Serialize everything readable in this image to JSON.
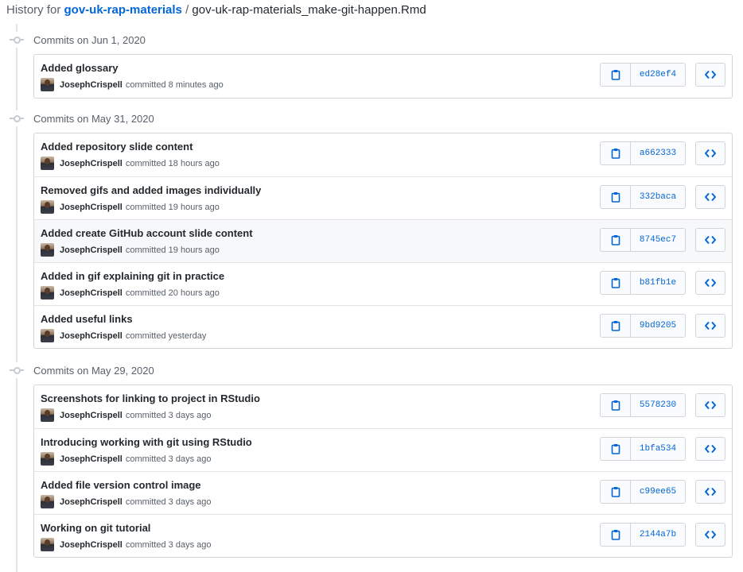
{
  "header": {
    "prefix": "History for",
    "repo": "gov-uk-rap-materials",
    "separator": "/",
    "file": "gov-uk-rap-materials_make-git-happen.Rmd"
  },
  "groups": [
    {
      "date_label": "Commits on Jun 1, 2020",
      "commits": [
        {
          "message": "Added glossary",
          "author": "JosephCrispell",
          "verb": "committed",
          "time": "8 minutes ago",
          "sha": "ed28ef4"
        }
      ]
    },
    {
      "date_label": "Commits on May 31, 2020",
      "commits": [
        {
          "message": "Added repository slide content",
          "author": "JosephCrispell",
          "verb": "committed",
          "time": "18 hours ago",
          "sha": "a662333"
        },
        {
          "message": "Removed gifs and added images individually",
          "author": "JosephCrispell",
          "verb": "committed",
          "time": "19 hours ago",
          "sha": "332baca"
        },
        {
          "message": "Added create GitHub account slide content",
          "author": "JosephCrispell",
          "verb": "committed",
          "time": "19 hours ago",
          "sha": "8745ec7"
        },
        {
          "message": "Added in gif explaining git in practice",
          "author": "JosephCrispell",
          "verb": "committed",
          "time": "20 hours ago",
          "sha": "b81fb1e"
        },
        {
          "message": "Added useful links",
          "author": "JosephCrispell",
          "verb": "committed",
          "time": "yesterday",
          "sha": "9bd9205"
        }
      ]
    },
    {
      "date_label": "Commits on May 29, 2020",
      "commits": [
        {
          "message": "Screenshots for linking to project in RStudio",
          "author": "JosephCrispell",
          "verb": "committed",
          "time": "3 days ago",
          "sha": "5578230"
        },
        {
          "message": "Introducing working with git using RStudio",
          "author": "JosephCrispell",
          "verb": "committed",
          "time": "3 days ago",
          "sha": "1bfa534"
        },
        {
          "message": "Added file version control image",
          "author": "JosephCrispell",
          "verb": "committed",
          "time": "3 days ago",
          "sha": "c99ee65"
        },
        {
          "message": "Working on git tutorial",
          "author": "JosephCrispell",
          "verb": "committed",
          "time": "3 days ago",
          "sha": "2144a7b"
        }
      ]
    }
  ],
  "icons": {
    "copy": "clipboard-icon",
    "browse": "code-icon",
    "commit": "git-commit-icon"
  },
  "colors": {
    "link": "#0366d6",
    "muted": "#586069",
    "border": "#d1d5da",
    "highlight_row": "#f6f8fa"
  },
  "highlighted_sha": "8745ec7"
}
